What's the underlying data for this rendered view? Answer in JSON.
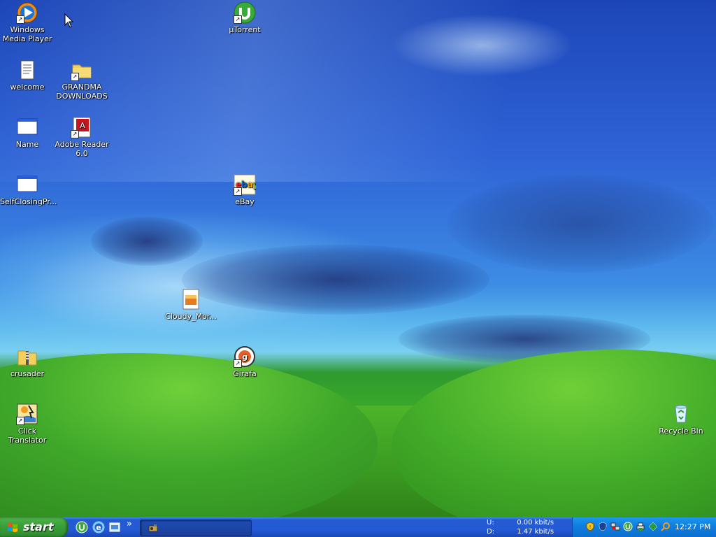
{
  "desktop": {
    "icons": [
      {
        "id": "wmp",
        "label": "Windows Media Player",
        "icon": "windows-media-player-icon",
        "shortcut": true
      },
      {
        "id": "utorrent",
        "label": "µTorrent",
        "icon": "utorrent-icon",
        "shortcut": true
      },
      {
        "id": "welcome",
        "label": "welcome",
        "icon": "text-document-icon",
        "shortcut": false
      },
      {
        "id": "grandma",
        "label": "GRANDMA DOWNLOADS",
        "icon": "folder-icon",
        "shortcut": true
      },
      {
        "id": "name",
        "label": "Name",
        "icon": "window-app-icon",
        "shortcut": false
      },
      {
        "id": "adobe",
        "label": "Adobe Reader 6.0",
        "icon": "adobe-reader-icon",
        "shortcut": true
      },
      {
        "id": "selfclosing",
        "label": "SelfClosingPr...",
        "icon": "window-app-icon",
        "shortcut": false
      },
      {
        "id": "ebay",
        "label": "eBay",
        "icon": "ebay-icon",
        "shortcut": true
      },
      {
        "id": "cloudy",
        "label": "Cloudy_Mor...",
        "icon": "image-file-icon",
        "shortcut": false
      },
      {
        "id": "crusader",
        "label": "crusader",
        "icon": "zip-folder-icon",
        "shortcut": false
      },
      {
        "id": "girafa",
        "label": "Girafa",
        "icon": "girafa-icon",
        "shortcut": true
      },
      {
        "id": "clicktranslator",
        "label": "Click Translator",
        "icon": "click-translator-icon",
        "shortcut": true
      },
      {
        "id": "recycle",
        "label": "Recycle Bin",
        "icon": "recycle-bin-icon",
        "shortcut": false
      }
    ]
  },
  "taskbar": {
    "start_label": "start",
    "quick_launch": [
      "utorrent-icon",
      "internet-explorer-icon",
      "show-desktop-icon"
    ],
    "chevron": "»",
    "net_monitor": {
      "up_label": "U:",
      "up_value": "0.00 kbit/s",
      "down_label": "D:",
      "down_value": "1.47 kbit/s"
    },
    "tray_icons": [
      "security-shield-icon",
      "defender-icon",
      "network-icon",
      "utorrent-tray-icon",
      "printer-icon",
      "app-icon",
      "search-tray-icon"
    ],
    "clock": "12:27 PM"
  }
}
